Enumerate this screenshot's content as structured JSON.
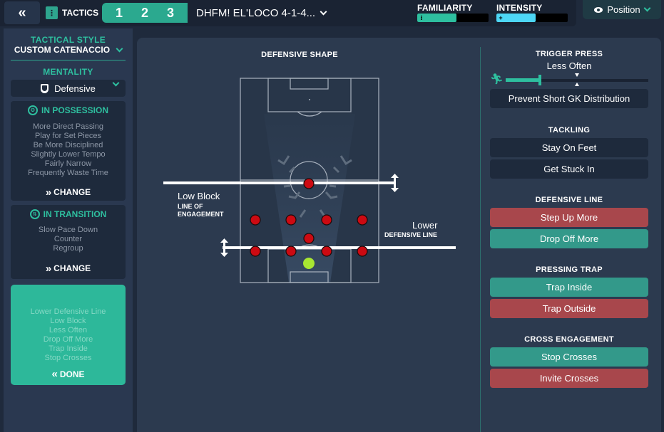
{
  "topbar": {
    "back_icon": "double-chevron-left-icon",
    "tactics_label": "TACTICS",
    "slots": [
      "1",
      "2",
      "3"
    ],
    "tactic_name": "DHFM! EL'LOCO 4-1-4...",
    "familiarity": {
      "label": "FAMILIARITY",
      "fill_fraction": 0.55,
      "color": "#2ebf9f"
    },
    "intensity": {
      "label": "INTENSITY",
      "fill_fraction": 0.55,
      "color": "#4dd6f5"
    },
    "position_button": "Position"
  },
  "sidebar": {
    "tactical_style_heading": "TACTICAL STYLE",
    "tactical_style_value": "CUSTOM CATENACCIO",
    "mentality_heading": "MENTALITY",
    "mentality_value": "Defensive",
    "in_possession": {
      "title": "IN POSSESSION",
      "instructions": [
        "More Direct Passing",
        "Play for Set Pieces",
        "Be More Disciplined",
        "Slightly Lower Tempo",
        "Fairly Narrow",
        "Frequently Waste Time"
      ],
      "action": "CHANGE"
    },
    "in_transition": {
      "title": "IN TRANSITION",
      "instructions": [
        "Slow Pace Down",
        "Counter",
        "Regroup"
      ],
      "action": "CHANGE"
    },
    "out_of_possession": {
      "instructions": [
        "Lower Defensive Line",
        "Low Block",
        "Less Often",
        "Drop Off More",
        "Trap Inside",
        "Stop Crosses"
      ],
      "action": "DONE"
    }
  },
  "shape": {
    "title": "DEFENSIVE SHAPE",
    "line_of_engagement": {
      "value": "Low Block",
      "label_line1": "LINE OF",
      "label_line2": "ENGAGEMENT"
    },
    "defensive_line": {
      "value": "Lower",
      "label": "DEFENSIVE LINE"
    },
    "colors": {
      "player": "#cc0a12",
      "goalkeeper": "#a8e632"
    }
  },
  "right": {
    "trigger_press": {
      "heading": "TRIGGER PRESS",
      "value": "Less Often",
      "level_fraction": 0.23,
      "button": "Prevent Short GK Distribution"
    },
    "tackling": {
      "heading": "TACKLING",
      "options": [
        "Stay On Feet",
        "Get Stuck In"
      ]
    },
    "defensive_line": {
      "heading": "DEFENSIVE LINE",
      "options": [
        "Step Up More",
        "Drop Off More"
      ]
    },
    "pressing_trap": {
      "heading": "PRESSING TRAP",
      "options": [
        "Trap Inside",
        "Trap Outside"
      ]
    },
    "cross_engagement": {
      "heading": "CROSS ENGAGEMENT",
      "options": [
        "Stop Crosses",
        "Invite Crosses"
      ]
    }
  }
}
